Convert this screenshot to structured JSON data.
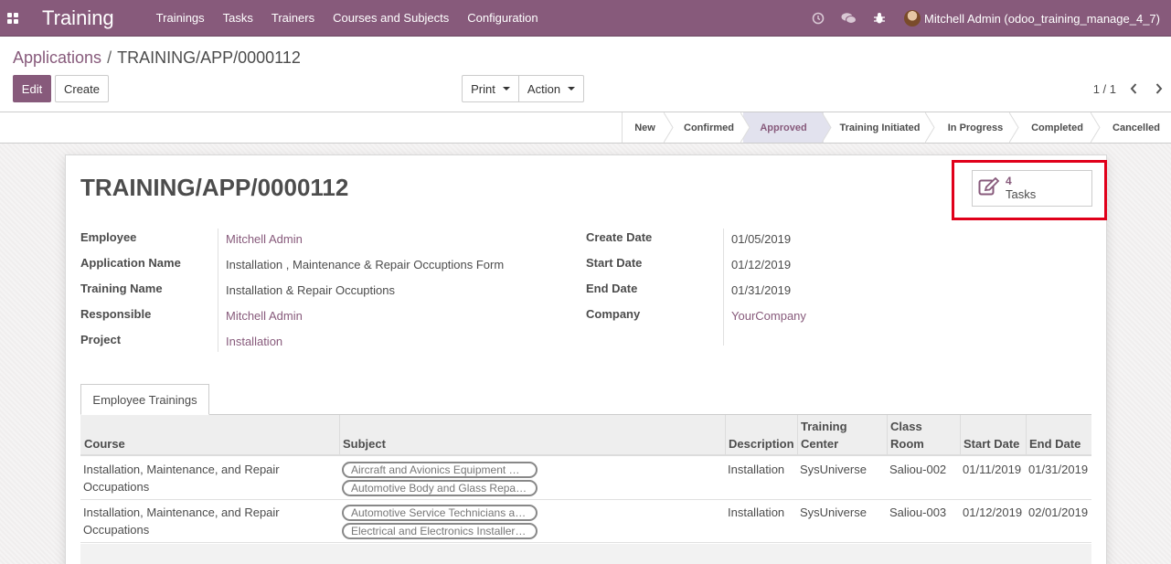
{
  "navbar": {
    "brand": "Training",
    "menu": [
      "Trainings",
      "Tasks",
      "Trainers",
      "Courses and Subjects",
      "Configuration"
    ],
    "user": "Mitchell Admin (odoo_training_manage_4_7)",
    "icons": [
      "clock-icon",
      "chat-icon",
      "bug-icon"
    ]
  },
  "breadcrumb": {
    "parent": "Applications",
    "separator": "/",
    "current": "TRAINING/APP/0000112"
  },
  "buttons": {
    "edit": "Edit",
    "create": "Create",
    "print": "Print",
    "action": "Action"
  },
  "pager": {
    "value": "1 / 1"
  },
  "statusbar": {
    "stages": [
      "New",
      "Confirmed",
      "Approved",
      "Training Initiated",
      "In Progress",
      "Completed",
      "Cancelled"
    ],
    "active": "Approved"
  },
  "record": {
    "title": "TRAINING/APP/0000112",
    "smart_button": {
      "count": "4",
      "label": "Tasks"
    },
    "left": [
      {
        "label": "Employee",
        "value": "Mitchell Admin",
        "link": true
      },
      {
        "label": "Application Name",
        "value": "Installation , Maintenance & Repair Occuptions Form",
        "link": false
      },
      {
        "label": "Training Name",
        "value": "Installation & Repair Occuptions",
        "link": false
      },
      {
        "label": "Responsible",
        "value": "Mitchell Admin",
        "link": true
      },
      {
        "label": "Project",
        "value": "Installation",
        "link": true
      }
    ],
    "right": [
      {
        "label": "Create Date",
        "value": "01/05/2019",
        "link": false
      },
      {
        "label": "Start Date",
        "value": "01/12/2019",
        "link": false
      },
      {
        "label": "End Date",
        "value": "01/31/2019",
        "link": false
      },
      {
        "label": "Company",
        "value": "YourCompany",
        "link": true
      }
    ]
  },
  "notebook": {
    "tab": "Employee Trainings",
    "columns": {
      "course": "Course",
      "subject": "Subject",
      "description": "Description",
      "training_center_1": "Training",
      "training_center_2": "Center",
      "class_room_1": "Class",
      "class_room_2": "Room",
      "start_date": "Start Date",
      "end_date": "End Date"
    },
    "rows": [
      {
        "course_1": "Installation, Maintenance, and Repair",
        "course_2": "Occupations",
        "tags": [
          "Aircraft and Avionics Equipment Mechanics",
          "Automotive Body and Glass Repairers"
        ],
        "description": "Installation",
        "center": "SysUniverse",
        "room": "Saliou-002",
        "start": "01/11/2019",
        "end": "01/31/2019"
      },
      {
        "course_1": "Installation, Maintenance, and Repair",
        "course_2": "Occupations",
        "tags": [
          "Automotive Service Technicians and Mechanics",
          "Electrical and Electronics Installers and Repairers"
        ],
        "description": "Installation",
        "center": "SysUniverse",
        "room": "Saliou-003",
        "start": "01/12/2019",
        "end": "02/01/2019"
      }
    ]
  },
  "colors": {
    "brand": "#875a7b",
    "highlight": "#e0001a",
    "active_stage_bg": "#e2e2ee"
  }
}
